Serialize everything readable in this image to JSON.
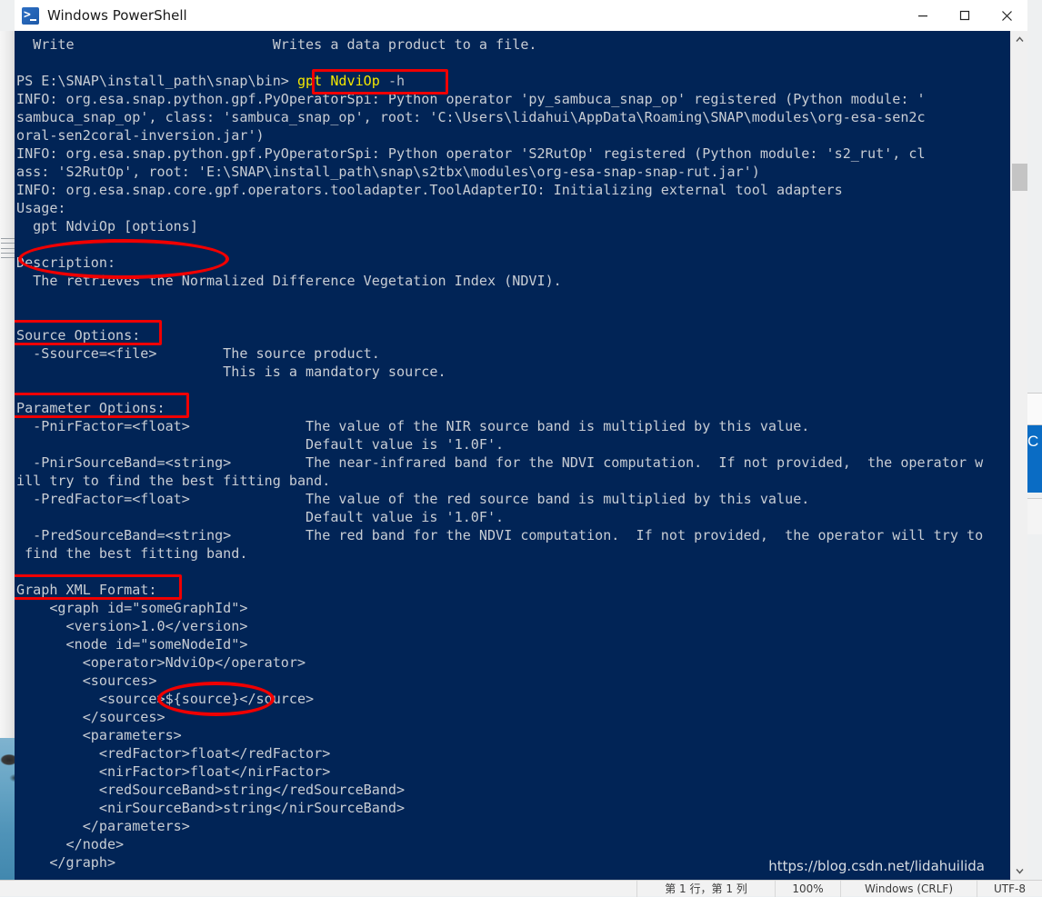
{
  "window": {
    "title": "Windows PowerShell",
    "icon": "powershell-icon",
    "controls": {
      "minimize": "minimize-icon",
      "maximize": "maximize-icon",
      "close": "close-icon"
    },
    "background_color": "#012456",
    "text_color": "#c8cdd4",
    "accent_color": "#f3e600",
    "annotation_color": "#f00000"
  },
  "console": {
    "lines": [
      "  Write                        Writes a data product to a file.",
      "",
      "PS E:\\SNAP\\install_path\\snap\\bin> gpt NdviOp -h",
      "INFO: org.esa.snap.python.gpf.PyOperatorSpi: Python operator 'py_sambuca_snap_op' registered (Python module: '",
      "sambuca_snap_op', class: 'sambuca_snap_op', root: 'C:\\Users\\lidahui\\AppData\\Roaming\\SNAP\\modules\\org-esa-sen2c",
      "oral-sen2coral-inversion.jar')",
      "INFO: org.esa.snap.python.gpf.PyOperatorSpi: Python operator 'S2RutOp' registered (Python module: 's2_rut', cl",
      "ass: 'S2RutOp', root: 'E:\\SNAP\\install_path\\snap\\s2tbx\\modules\\org-esa-snap-snap-rut.jar')",
      "INFO: org.esa.snap.core.gpf.operators.tooladapter.ToolAdapterIO: Initializing external tool adapters",
      "Usage:",
      "  gpt NdviOp [options]",
      "",
      "Description:",
      "  The retrieves the Normalized Difference Vegetation Index (NDVI).",
      "",
      "",
      "Source Options:",
      "  -Ssource=<file>        The source product.",
      "                         This is a mandatory source.",
      "",
      "Parameter Options:",
      "  -PnirFactor=<float>              The value of the NIR source band is multiplied by this value.",
      "                                   Default value is '1.0F'.",
      "  -PnirSourceBand=<string>         The near-infrared band for the NDVI computation.  If not provided,  the operator w",
      "ill try to find the best fitting band.",
      "  -PredFactor=<float>              The value of the red source band is multiplied by this value.",
      "                                   Default value is '1.0F'.",
      "  -PredSourceBand=<string>         The red band for the NDVI computation.  If not provided,  the operator will try to",
      " find the best fitting band.",
      "",
      "Graph XML Format:",
      "    <graph id=\"someGraphId\">",
      "      <version>1.0</version>",
      "      <node id=\"someNodeId\">",
      "        <operator>NdviOp</operator>",
      "        <sources>",
      "          <source>${source}</source>",
      "        </sources>",
      "        <parameters>",
      "          <redFactor>float</redFactor>",
      "          <nirFactor>float</nirFactor>",
      "          <redSourceBand>string</redSourceBand>",
      "          <nirSourceBand>string</nirSourceBand>",
      "        </parameters>",
      "      </node>",
      "    </graph>"
    ],
    "prompt": "PS E:\\SNAP\\install_path\\snap\\bin>",
    "command": "gpt NdviOp",
    "command_flag": "-h"
  },
  "annotations": [
    {
      "name": "highlight-command",
      "shape": "rect",
      "label": "gpt NdviOp -h"
    },
    {
      "name": "highlight-usage",
      "shape": "oval",
      "label": "gpt NdviOp [options]"
    },
    {
      "name": "highlight-source-options",
      "shape": "rect",
      "label": "Source Options:"
    },
    {
      "name": "highlight-parameter-options",
      "shape": "rect",
      "label": "Parameter Options:"
    },
    {
      "name": "highlight-graph-xml-format",
      "shape": "rect",
      "label": "Graph XML Format:"
    },
    {
      "name": "highlight-source-variable",
      "shape": "oval",
      "label": "${source}"
    }
  ],
  "watermark": "https://blog.csdn.net/lidahuilida",
  "background_status_bar": {
    "cursor_position": "第 1 行，第 1 列",
    "zoom": "100%",
    "line_ending": "Windows (CRLF)",
    "encoding": "UTF-8"
  },
  "right_edge_window": {
    "visible_text": "C"
  },
  "scrollbar": {
    "up_arrow": "chevron-up-icon",
    "down_arrow": "chevron-down-icon"
  }
}
